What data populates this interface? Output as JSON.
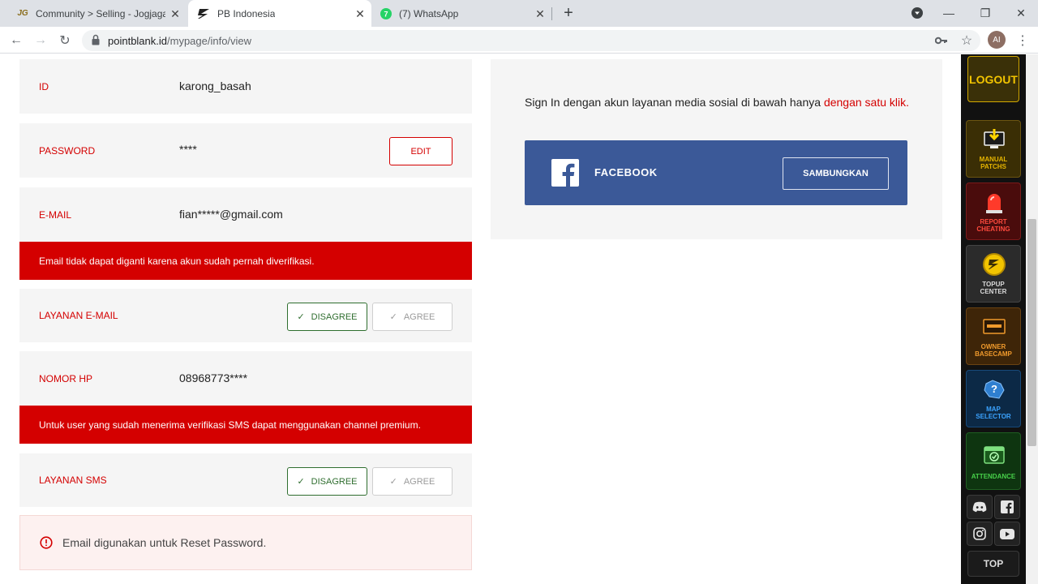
{
  "browser": {
    "tabs": [
      {
        "title": "Community > Selling - Jogjagam",
        "favicon": "jg-icon"
      },
      {
        "title": "PB Indonesia",
        "favicon": "pb-logo-icon",
        "active": true
      },
      {
        "title": "(7) WhatsApp",
        "favicon": "whatsapp-icon"
      }
    ],
    "url_host": "pointblank.id",
    "url_path": "/mypage/info/view",
    "profile_initials": "AI"
  },
  "account": {
    "id_label": "ID",
    "id_value": "karong_basah",
    "password_label": "PASSWORD",
    "password_value": "****",
    "edit_label": "EDIT",
    "email_label": "E-MAIL",
    "email_value": "fian*****@gmail.com",
    "email_alert": "Email tidak dapat diganti karena akun sudah pernah diverifikasi.",
    "email_service_label": "LAYANAN E-MAIL",
    "phone_label": "NOMOR HP",
    "phone_value": "08968773****",
    "sms_alert": "Untuk user yang sudah menerima verifikasi SMS dapat menggunakan channel premium.",
    "sms_service_label": "LAYANAN SMS",
    "disagree_label": "DISAGREE",
    "agree_label": "AGREE",
    "reset_note": "Email digunakan untuk Reset Password."
  },
  "social": {
    "intro": "Sign In dengan akun layanan media sosial di bawah hanya ",
    "intro_highlight": "dengan satu klik.",
    "facebook_label": "FACEBOOK",
    "connect_label": "SAMBUNGKAN",
    "colors": {
      "facebook": "#3b5998",
      "accent": "#d40000"
    }
  },
  "sidemenu": {
    "logout": "LOGOUT",
    "items": [
      {
        "line1": "MANUAL",
        "line2": "PATCHS",
        "color": "#e5b400",
        "bg": "#3a2e05"
      },
      {
        "line1": "REPORT",
        "line2": "CHEATING",
        "color": "#ff4a3d",
        "bg": "#4a0c0c"
      },
      {
        "line1": "TOPUP",
        "line2": "CENTER",
        "color": "#d9d9d9",
        "bg": "#2b2b2b"
      },
      {
        "line1": "OWNER",
        "line2": "BASECAMP",
        "color": "#f09a2c",
        "bg": "#3e2508"
      },
      {
        "line1": "MAP",
        "line2": "SELECTOR",
        "color": "#3ba3ff",
        "bg": "#0c2946"
      },
      {
        "line1": "ATTENDANCE",
        "line2": "",
        "color": "#47d14a",
        "bg": "#0e3510"
      }
    ],
    "top_label": "TOP"
  }
}
